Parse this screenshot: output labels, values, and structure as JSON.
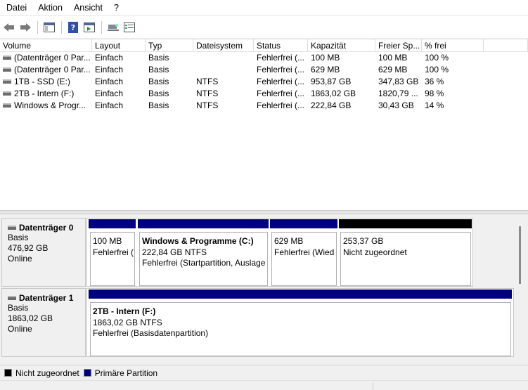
{
  "menu": [
    "Datei",
    "Aktion",
    "Ansicht",
    "?"
  ],
  "toolbar": {
    "icons": [
      "back-arrow-icon",
      "forward-arrow-icon",
      "console-tree-icon",
      "help-icon",
      "action-pane-icon",
      "connect-icon",
      "properties-icon"
    ]
  },
  "columns": [
    "Volume",
    "Layout",
    "Typ",
    "Dateisystem",
    "Status",
    "Kapazität",
    "Freier Sp...",
    "% frei",
    ""
  ],
  "volumes": [
    {
      "volume": "(Datenträger 0 Par...",
      "layout": "Einfach",
      "typ": "Basis",
      "fs": "",
      "status": "Fehlerfrei (...",
      "kap": "100 MB",
      "frei": "100 MB",
      "pct": "100 %"
    },
    {
      "volume": "(Datenträger 0 Par...",
      "layout": "Einfach",
      "typ": "Basis",
      "fs": "",
      "status": "Fehlerfrei (...",
      "kap": "629 MB",
      "frei": "629 MB",
      "pct": "100 %"
    },
    {
      "volume": "1TB - SSD (E:)",
      "layout": "Einfach",
      "typ": "Basis",
      "fs": "NTFS",
      "status": "Fehlerfrei (...",
      "kap": "953,87 GB",
      "frei": "347,83 GB",
      "pct": "36 %"
    },
    {
      "volume": "2TB - Intern (F:)",
      "layout": "Einfach",
      "typ": "Basis",
      "fs": "NTFS",
      "status": "Fehlerfrei (...",
      "kap": "1863,02 GB",
      "frei": "1820,79 ...",
      "pct": "98 %"
    },
    {
      "volume": "Windows & Progr...",
      "layout": "Einfach",
      "typ": "Basis",
      "fs": "NTFS",
      "status": "Fehlerfrei (...",
      "kap": "222,84 GB",
      "frei": "30,43 GB",
      "pct": "14 %"
    }
  ],
  "disks": [
    {
      "name": "Datenträger 0",
      "type": "Basis",
      "size": "476,92 GB",
      "state": "Online",
      "partitions": [
        {
          "title": "",
          "size": "100 MB",
          "status": "Fehlerfrei (",
          "kind": "primary"
        },
        {
          "title": "Windows & Programme  (C:)",
          "size": "222,84 GB NTFS",
          "status": "Fehlerfrei (Startpartition, Auslage",
          "kind": "primary"
        },
        {
          "title": "",
          "size": "629 MB",
          "status": "Fehlerfrei (Wied",
          "kind": "primary"
        },
        {
          "title": "",
          "size": "253,37 GB",
          "status": "Nicht zugeordnet",
          "kind": "unalloc"
        }
      ]
    },
    {
      "name": "Datenträger 1",
      "type": "Basis",
      "size": "1863,02 GB",
      "state": "Online",
      "partitions": [
        {
          "title": "2TB - Intern  (F:)",
          "size": "1863,02 GB NTFS",
          "status": "Fehlerfrei (Basisdatenpartition)",
          "kind": "primary"
        }
      ]
    }
  ],
  "legend": [
    {
      "label": "Nicht zugeordnet",
      "color": "#000000"
    },
    {
      "label": "Primäre Partition",
      "color": "#000080"
    }
  ]
}
